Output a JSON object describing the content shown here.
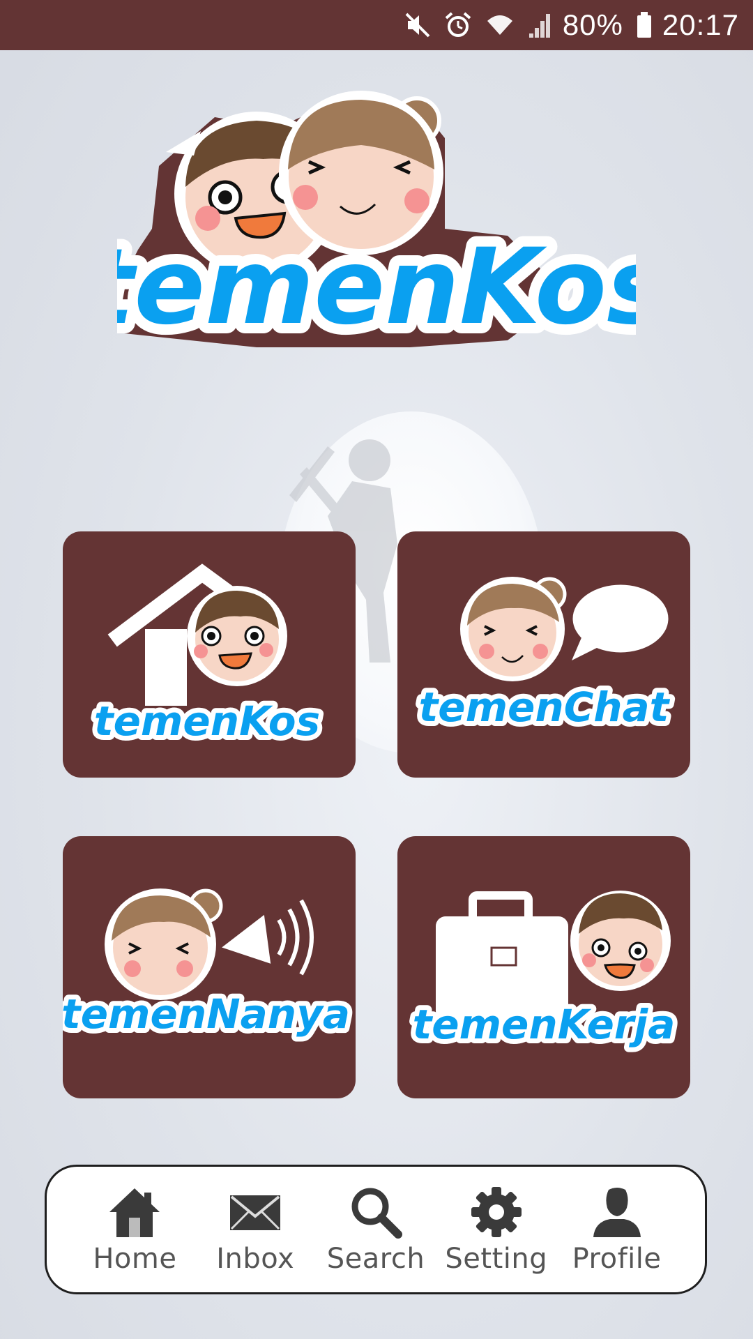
{
  "status_bar": {
    "battery": "80%",
    "time": "20:17",
    "icons": [
      "mute-icon",
      "alarm-icon",
      "wifi-icon",
      "signal-icon",
      "battery-icon"
    ]
  },
  "logo": {
    "text": "temenKos"
  },
  "menu": {
    "tiles": [
      {
        "label": "temenKos",
        "icon": "house-boy-icon"
      },
      {
        "label": "temenChat",
        "icon": "girl-speech-bubble-icon"
      },
      {
        "label": "temenNanya",
        "icon": "girl-megaphone-icon"
      },
      {
        "label": "temenKerja",
        "icon": "briefcase-boy-icon"
      }
    ]
  },
  "bottom_nav": {
    "items": [
      {
        "label": "Home",
        "icon": "home-icon"
      },
      {
        "label": "Inbox",
        "icon": "envelope-icon"
      },
      {
        "label": "Search",
        "icon": "search-icon"
      },
      {
        "label": "Setting",
        "icon": "gear-icon"
      },
      {
        "label": "Profile",
        "icon": "person-icon"
      }
    ]
  },
  "colors": {
    "brand_brown": "#633434",
    "brand_blue": "#0aa0f0",
    "brand_dark_blue": "#0d6fb5"
  }
}
